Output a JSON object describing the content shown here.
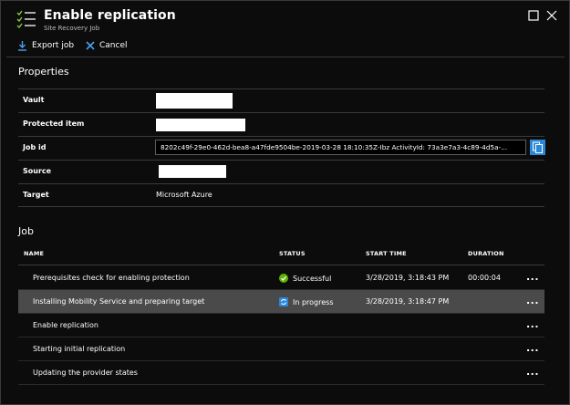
{
  "header": {
    "title": "Enable replication",
    "subtitle": "Site Recovery Job",
    "icon": "job-checklist-icon"
  },
  "toolbar": {
    "export_label": "Export job",
    "cancel_label": "Cancel"
  },
  "properties": {
    "section_title": "Properties",
    "rows": [
      {
        "label": "Vault",
        "value": ""
      },
      {
        "label": "Protected item",
        "value": ""
      },
      {
        "label": "Job id",
        "value": "8202c49f-29e0-462d-bea8-a47fde9504be-2019-03-28 18:10:35Z-Ibz ActivityId: 73a3e7a3-4c89-4d5a-..."
      },
      {
        "label": "Source",
        "value": ""
      },
      {
        "label": "Target",
        "value": "Microsoft Azure"
      }
    ]
  },
  "job": {
    "section_title": "Job",
    "columns": [
      "NAME",
      "STATUS",
      "START TIME",
      "DURATION"
    ],
    "rows": [
      {
        "name": "Prerequisites check for enabling protection",
        "status": "Successful",
        "status_icon": "success-check-icon",
        "start": "3/28/2019, 3:18:43 PM",
        "duration": "00:00:04",
        "more": "..."
      },
      {
        "name": "Installing Mobility Service and preparing target",
        "status": "In progress",
        "status_icon": "in-progress-icon",
        "start": "3/28/2019, 3:18:47 PM",
        "duration": "",
        "more": "..."
      },
      {
        "name": "Enable replication",
        "status": "",
        "start": "",
        "duration": "",
        "more": "..."
      },
      {
        "name": "Starting initial replication",
        "status": "",
        "start": "",
        "duration": "",
        "more": "..."
      },
      {
        "name": "Updating the provider states",
        "status": "",
        "start": "",
        "duration": "",
        "more": "..."
      }
    ]
  },
  "colors": {
    "accent": "#2b88d8",
    "success": "#5db300",
    "selected_row": "#4a4a4a",
    "checklist": "#8cc63f"
  }
}
